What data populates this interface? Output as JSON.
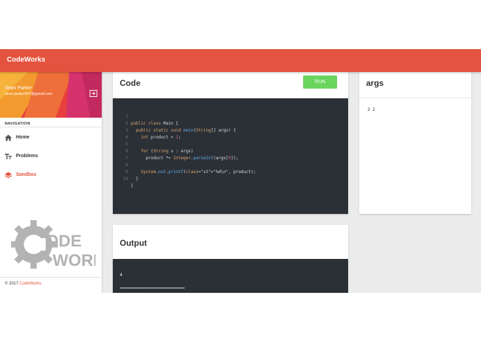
{
  "app": {
    "title": "CodeWorks"
  },
  "user": {
    "name": "Sean Parker",
    "email": "sean.parker067@gmail.com"
  },
  "nav": {
    "header": "NAVIGATION",
    "items": [
      {
        "label": "Home",
        "icon": "home-icon"
      },
      {
        "label": "Problems",
        "icon": "text-format-icon"
      },
      {
        "label": "Sandbox",
        "icon": "layers-icon",
        "active": true
      }
    ]
  },
  "logo": {
    "text_top": "ODE",
    "text_bottom": "WORKS"
  },
  "footer": {
    "prefix": "© 2017",
    "brand": "CodeWorks."
  },
  "code_card": {
    "title": "Code",
    "run_label": "RUN"
  },
  "code_lines": [
    {
      "num": "1",
      "text": "public class Main {"
    },
    {
      "num": "2",
      "text": "  public static void main(String[] args) {"
    },
    {
      "num": "3",
      "text": "    int product = 1;"
    },
    {
      "num": "4",
      "text": ""
    },
    {
      "num": "5",
      "text": "    for (String s : args)"
    },
    {
      "num": "6",
      "text": "      product *= Integer.parseInt(args[0]);"
    },
    {
      "num": "7",
      "text": ""
    },
    {
      "num": "8",
      "text": "    System.out.printf(\"%d\\n\", product);"
    },
    {
      "num": "9",
      "text": "  }"
    },
    {
      "num": "10",
      "text": "}"
    }
  ],
  "args_card": {
    "title": "args",
    "value": "2 2"
  },
  "output_card": {
    "title": "Output",
    "lines": [
      "4",
      "=========================="
    ]
  },
  "colors": {
    "accent": "#e4533f",
    "run": "#6bd45e",
    "editor_bg": "#2b3036"
  }
}
